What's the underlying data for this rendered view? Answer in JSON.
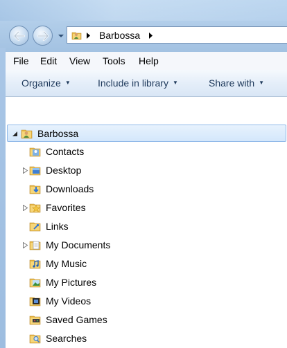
{
  "address_bar": {
    "path": [
      "Barbossa"
    ]
  },
  "menu": {
    "items": [
      "File",
      "Edit",
      "View",
      "Tools",
      "Help"
    ]
  },
  "command_bar": {
    "organize": "Organize",
    "include_in_library": "Include in library",
    "share_with": "Share with"
  },
  "tree": {
    "root": {
      "label": "Barbossa",
      "expanded": true,
      "selected": true
    },
    "children": [
      {
        "label": "Contacts",
        "expandable": false,
        "icon": "contacts-folder-icon"
      },
      {
        "label": "Desktop",
        "expandable": true,
        "icon": "desktop-folder-icon"
      },
      {
        "label": "Downloads",
        "expandable": false,
        "icon": "downloads-folder-icon"
      },
      {
        "label": "Favorites",
        "expandable": true,
        "icon": "favorites-folder-icon"
      },
      {
        "label": "Links",
        "expandable": false,
        "icon": "links-folder-icon"
      },
      {
        "label": "My Documents",
        "expandable": true,
        "icon": "documents-folder-icon"
      },
      {
        "label": "My Music",
        "expandable": false,
        "icon": "music-folder-icon"
      },
      {
        "label": "My Pictures",
        "expandable": false,
        "icon": "pictures-folder-icon"
      },
      {
        "label": "My Videos",
        "expandable": false,
        "icon": "videos-folder-icon"
      },
      {
        "label": "Saved Games",
        "expandable": false,
        "icon": "saved-games-folder-icon"
      },
      {
        "label": "Searches",
        "expandable": false,
        "icon": "searches-folder-icon"
      }
    ]
  },
  "colors": {
    "selection_fill": "#d4e7fb",
    "selection_border": "#8fb8e8",
    "command_text": "#1e395b",
    "folder_yellow": "#f2c65a"
  }
}
